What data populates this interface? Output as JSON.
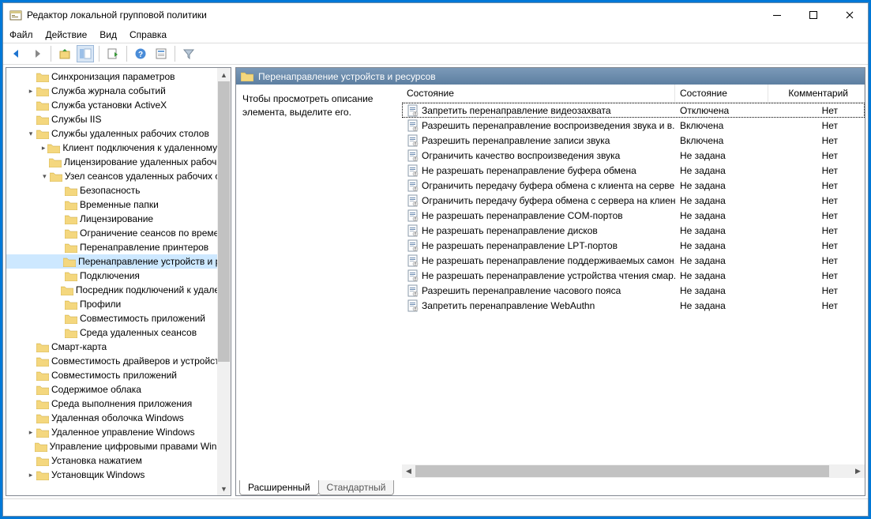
{
  "window": {
    "title": "Редактор локальной групповой политики"
  },
  "menu": {
    "file": "Файл",
    "action": "Действие",
    "view": "Вид",
    "help": "Справка"
  },
  "tree": [
    {
      "indent": 1,
      "exp": "",
      "label": "Синхронизация параметров"
    },
    {
      "indent": 1,
      "exp": "▸",
      "label": "Служба журнала событий"
    },
    {
      "indent": 1,
      "exp": "",
      "label": "Служба установки ActiveX"
    },
    {
      "indent": 1,
      "exp": "",
      "label": "Службы IIS"
    },
    {
      "indent": 1,
      "exp": "▾",
      "label": "Службы удаленных рабочих столов"
    },
    {
      "indent": 2,
      "exp": "▸",
      "label": "Клиент подключения к удаленному рабочему столу"
    },
    {
      "indent": 2,
      "exp": "",
      "label": "Лицензирование удаленных рабочих столов"
    },
    {
      "indent": 2,
      "exp": "▾",
      "label": "Узел сеансов удаленных рабочих столов"
    },
    {
      "indent": 3,
      "exp": "",
      "label": "Безопасность"
    },
    {
      "indent": 3,
      "exp": "",
      "label": "Временные папки"
    },
    {
      "indent": 3,
      "exp": "",
      "label": "Лицензирование"
    },
    {
      "indent": 3,
      "exp": "",
      "label": "Ограничение сеансов по времени"
    },
    {
      "indent": 3,
      "exp": "",
      "label": "Перенаправление принтеров"
    },
    {
      "indent": 3,
      "exp": "",
      "label": "Перенаправление устройств и ресурсов",
      "selected": true
    },
    {
      "indent": 3,
      "exp": "",
      "label": "Подключения"
    },
    {
      "indent": 3,
      "exp": "",
      "label": "Посредник подключений к удаленному рабочему столу"
    },
    {
      "indent": 3,
      "exp": "",
      "label": "Профили"
    },
    {
      "indent": 3,
      "exp": "",
      "label": "Совместимость приложений"
    },
    {
      "indent": 3,
      "exp": "",
      "label": "Среда удаленных сеансов"
    },
    {
      "indent": 1,
      "exp": "",
      "label": "Смарт-карта"
    },
    {
      "indent": 1,
      "exp": "",
      "label": "Совместимость драйверов и устройств"
    },
    {
      "indent": 1,
      "exp": "",
      "label": "Совместимость приложений"
    },
    {
      "indent": 1,
      "exp": "",
      "label": "Содержимое облака"
    },
    {
      "indent": 1,
      "exp": "",
      "label": "Среда выполнения приложения"
    },
    {
      "indent": 1,
      "exp": "",
      "label": "Удаленная оболочка Windows"
    },
    {
      "indent": 1,
      "exp": "▸",
      "label": "Удаленное управление Windows"
    },
    {
      "indent": 1,
      "exp": "",
      "label": "Управление цифровыми правами Windows Media"
    },
    {
      "indent": 1,
      "exp": "",
      "label": "Установка нажатием"
    },
    {
      "indent": 1,
      "exp": "▸",
      "label": "Установщик Windows"
    }
  ],
  "header_title": "Перенаправление устройств и ресурсов",
  "description": "Чтобы просмотреть описание элемента, выделите его.",
  "columns": {
    "name": "Состояние",
    "state": "Состояние",
    "comment": "Комментарий"
  },
  "policies": [
    {
      "name": "Запретить перенаправление видеозахвата",
      "state": "Отключена",
      "comment": "Нет",
      "focused": true
    },
    {
      "name": "Разрешить перенаправление воспроизведения звука и в...",
      "state": "Включена",
      "comment": "Нет"
    },
    {
      "name": "Разрешить перенаправление записи звука",
      "state": "Включена",
      "comment": "Нет"
    },
    {
      "name": "Ограничить качество воспроизведения звука",
      "state": "Не задана",
      "comment": "Нет"
    },
    {
      "name": "Не разрешать перенаправление буфера обмена",
      "state": "Не задана",
      "comment": "Нет"
    },
    {
      "name": "Ограничить передачу буфера обмена с клиента на сервер",
      "state": "Не задана",
      "comment": "Нет"
    },
    {
      "name": "Ограничить передачу буфера обмена с сервера на клиент",
      "state": "Не задана",
      "comment": "Нет"
    },
    {
      "name": "Не разрешать перенаправление COM-портов",
      "state": "Не задана",
      "comment": "Нет"
    },
    {
      "name": "Не разрешать перенаправление дисков",
      "state": "Не задана",
      "comment": "Нет"
    },
    {
      "name": "Не разрешать перенаправление LPT-портов",
      "state": "Не задана",
      "comment": "Нет"
    },
    {
      "name": "Не разрешать перенаправление поддерживаемых самон...",
      "state": "Не задана",
      "comment": "Нет"
    },
    {
      "name": "Не разрешать перенаправление устройства чтения смар...",
      "state": "Не задана",
      "comment": "Нет"
    },
    {
      "name": "Разрешить перенаправление часового пояса",
      "state": "Не задана",
      "comment": "Нет"
    },
    {
      "name": "Запретить перенаправление WebAuthn",
      "state": "Не задана",
      "comment": "Нет"
    }
  ],
  "tabs": {
    "extended": "Расширенный",
    "standard": "Стандартный"
  }
}
